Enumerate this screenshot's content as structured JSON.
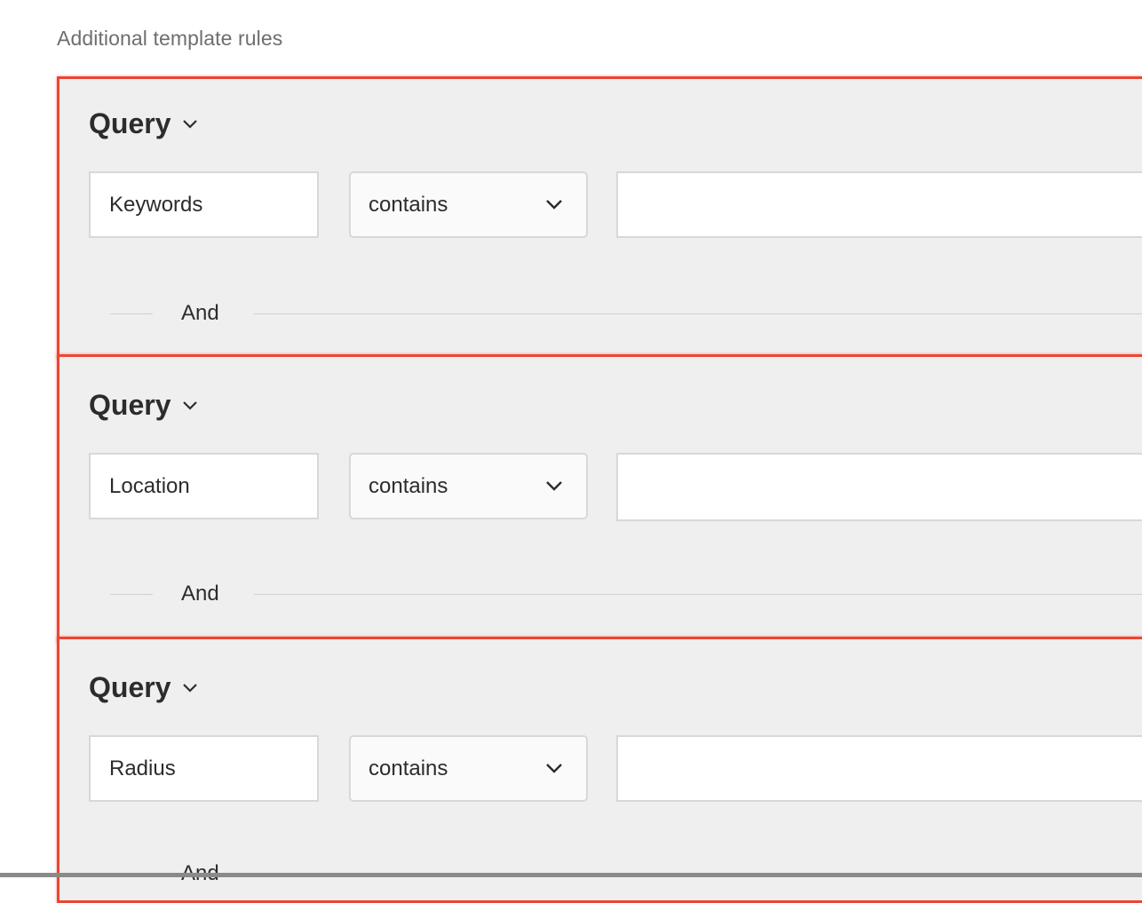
{
  "section": {
    "title": "Additional template rules"
  },
  "rules": [
    {
      "title": "Query",
      "field": "Keywords",
      "operator": "contains",
      "value": "",
      "connector": "And"
    },
    {
      "title": "Query",
      "field": "Location",
      "operator": "contains",
      "value": "",
      "connector": "And"
    },
    {
      "title": "Query",
      "field": "Radius",
      "operator": "contains",
      "value": "",
      "connector": "And"
    }
  ],
  "colors": {
    "highlight_border": "#ee4533",
    "block_background": "#efefef",
    "muted_text": "#6e6e6e"
  },
  "icons": {
    "header_toggle": "chevron-down-icon",
    "select_toggle": "chevron-down-icon"
  }
}
